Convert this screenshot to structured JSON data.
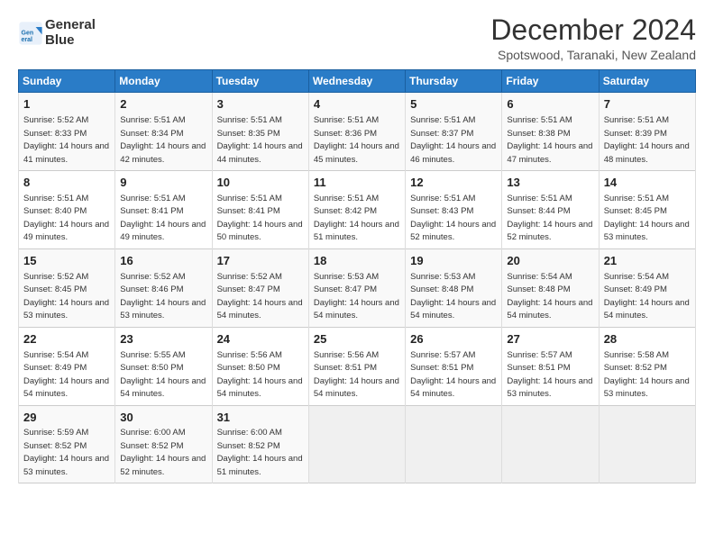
{
  "header": {
    "logo_line1": "General",
    "logo_line2": "Blue",
    "month": "December 2024",
    "location": "Spotswood, Taranaki, New Zealand"
  },
  "weekdays": [
    "Sunday",
    "Monday",
    "Tuesday",
    "Wednesday",
    "Thursday",
    "Friday",
    "Saturday"
  ],
  "weeks": [
    [
      {
        "day": "1",
        "sunrise": "Sunrise: 5:52 AM",
        "sunset": "Sunset: 8:33 PM",
        "daylight": "Daylight: 14 hours and 41 minutes."
      },
      {
        "day": "2",
        "sunrise": "Sunrise: 5:51 AM",
        "sunset": "Sunset: 8:34 PM",
        "daylight": "Daylight: 14 hours and 42 minutes."
      },
      {
        "day": "3",
        "sunrise": "Sunrise: 5:51 AM",
        "sunset": "Sunset: 8:35 PM",
        "daylight": "Daylight: 14 hours and 44 minutes."
      },
      {
        "day": "4",
        "sunrise": "Sunrise: 5:51 AM",
        "sunset": "Sunset: 8:36 PM",
        "daylight": "Daylight: 14 hours and 45 minutes."
      },
      {
        "day": "5",
        "sunrise": "Sunrise: 5:51 AM",
        "sunset": "Sunset: 8:37 PM",
        "daylight": "Daylight: 14 hours and 46 minutes."
      },
      {
        "day": "6",
        "sunrise": "Sunrise: 5:51 AM",
        "sunset": "Sunset: 8:38 PM",
        "daylight": "Daylight: 14 hours and 47 minutes."
      },
      {
        "day": "7",
        "sunrise": "Sunrise: 5:51 AM",
        "sunset": "Sunset: 8:39 PM",
        "daylight": "Daylight: 14 hours and 48 minutes."
      }
    ],
    [
      {
        "day": "8",
        "sunrise": "Sunrise: 5:51 AM",
        "sunset": "Sunset: 8:40 PM",
        "daylight": "Daylight: 14 hours and 49 minutes."
      },
      {
        "day": "9",
        "sunrise": "Sunrise: 5:51 AM",
        "sunset": "Sunset: 8:41 PM",
        "daylight": "Daylight: 14 hours and 49 minutes."
      },
      {
        "day": "10",
        "sunrise": "Sunrise: 5:51 AM",
        "sunset": "Sunset: 8:41 PM",
        "daylight": "Daylight: 14 hours and 50 minutes."
      },
      {
        "day": "11",
        "sunrise": "Sunrise: 5:51 AM",
        "sunset": "Sunset: 8:42 PM",
        "daylight": "Daylight: 14 hours and 51 minutes."
      },
      {
        "day": "12",
        "sunrise": "Sunrise: 5:51 AM",
        "sunset": "Sunset: 8:43 PM",
        "daylight": "Daylight: 14 hours and 52 minutes."
      },
      {
        "day": "13",
        "sunrise": "Sunrise: 5:51 AM",
        "sunset": "Sunset: 8:44 PM",
        "daylight": "Daylight: 14 hours and 52 minutes."
      },
      {
        "day": "14",
        "sunrise": "Sunrise: 5:51 AM",
        "sunset": "Sunset: 8:45 PM",
        "daylight": "Daylight: 14 hours and 53 minutes."
      }
    ],
    [
      {
        "day": "15",
        "sunrise": "Sunrise: 5:52 AM",
        "sunset": "Sunset: 8:45 PM",
        "daylight": "Daylight: 14 hours and 53 minutes."
      },
      {
        "day": "16",
        "sunrise": "Sunrise: 5:52 AM",
        "sunset": "Sunset: 8:46 PM",
        "daylight": "Daylight: 14 hours and 53 minutes."
      },
      {
        "day": "17",
        "sunrise": "Sunrise: 5:52 AM",
        "sunset": "Sunset: 8:47 PM",
        "daylight": "Daylight: 14 hours and 54 minutes."
      },
      {
        "day": "18",
        "sunrise": "Sunrise: 5:53 AM",
        "sunset": "Sunset: 8:47 PM",
        "daylight": "Daylight: 14 hours and 54 minutes."
      },
      {
        "day": "19",
        "sunrise": "Sunrise: 5:53 AM",
        "sunset": "Sunset: 8:48 PM",
        "daylight": "Daylight: 14 hours and 54 minutes."
      },
      {
        "day": "20",
        "sunrise": "Sunrise: 5:54 AM",
        "sunset": "Sunset: 8:48 PM",
        "daylight": "Daylight: 14 hours and 54 minutes."
      },
      {
        "day": "21",
        "sunrise": "Sunrise: 5:54 AM",
        "sunset": "Sunset: 8:49 PM",
        "daylight": "Daylight: 14 hours and 54 minutes."
      }
    ],
    [
      {
        "day": "22",
        "sunrise": "Sunrise: 5:54 AM",
        "sunset": "Sunset: 8:49 PM",
        "daylight": "Daylight: 14 hours and 54 minutes."
      },
      {
        "day": "23",
        "sunrise": "Sunrise: 5:55 AM",
        "sunset": "Sunset: 8:50 PM",
        "daylight": "Daylight: 14 hours and 54 minutes."
      },
      {
        "day": "24",
        "sunrise": "Sunrise: 5:56 AM",
        "sunset": "Sunset: 8:50 PM",
        "daylight": "Daylight: 14 hours and 54 minutes."
      },
      {
        "day": "25",
        "sunrise": "Sunrise: 5:56 AM",
        "sunset": "Sunset: 8:51 PM",
        "daylight": "Daylight: 14 hours and 54 minutes."
      },
      {
        "day": "26",
        "sunrise": "Sunrise: 5:57 AM",
        "sunset": "Sunset: 8:51 PM",
        "daylight": "Daylight: 14 hours and 54 minutes."
      },
      {
        "day": "27",
        "sunrise": "Sunrise: 5:57 AM",
        "sunset": "Sunset: 8:51 PM",
        "daylight": "Daylight: 14 hours and 53 minutes."
      },
      {
        "day": "28",
        "sunrise": "Sunrise: 5:58 AM",
        "sunset": "Sunset: 8:52 PM",
        "daylight": "Daylight: 14 hours and 53 minutes."
      }
    ],
    [
      {
        "day": "29",
        "sunrise": "Sunrise: 5:59 AM",
        "sunset": "Sunset: 8:52 PM",
        "daylight": "Daylight: 14 hours and 53 minutes."
      },
      {
        "day": "30",
        "sunrise": "Sunrise: 6:00 AM",
        "sunset": "Sunset: 8:52 PM",
        "daylight": "Daylight: 14 hours and 52 minutes."
      },
      {
        "day": "31",
        "sunrise": "Sunrise: 6:00 AM",
        "sunset": "Sunset: 8:52 PM",
        "daylight": "Daylight: 14 hours and 51 minutes."
      },
      null,
      null,
      null,
      null
    ]
  ]
}
